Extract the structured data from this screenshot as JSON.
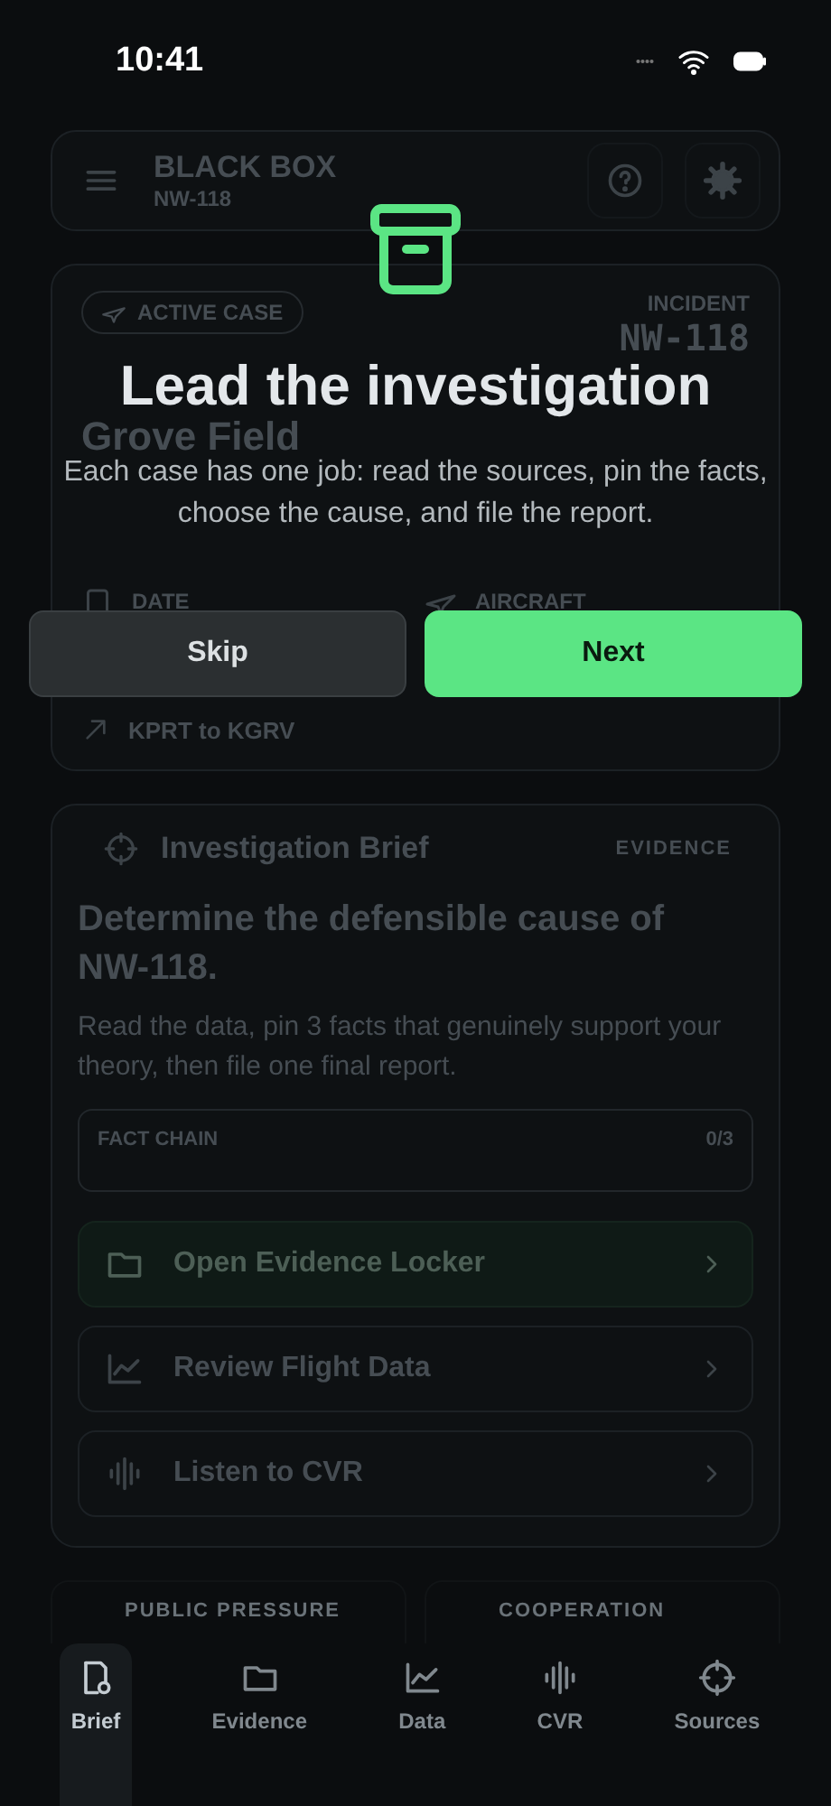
{
  "status_bar": {
    "time": "10:41"
  },
  "header": {
    "title": "BLACK BOX",
    "subtitle": "NW-118"
  },
  "case": {
    "badge": "ACTIVE CASE",
    "title": "Grove Field",
    "incident_label": "INCIDENT",
    "incident_id": "NW-118",
    "meta": [
      {
        "kind": "date",
        "label": "DATE"
      },
      {
        "kind": "aircraft",
        "label": "AIRCRAFT"
      }
    ],
    "route": "KPRT to KGRV"
  },
  "brief": {
    "title": "Investigation Brief",
    "tag": "EVIDENCE",
    "heading": "Determine the defensible cause of NW-118.",
    "body": "Read the data, pin 3 facts that genuinely support your theory, then file one final report.",
    "fact_chain": {
      "label": "FACT CHAIN",
      "count": "0/3"
    },
    "actions": [
      {
        "kind": "folder",
        "label": "Open Evidence Locker",
        "primary": true
      },
      {
        "kind": "chart",
        "label": "Review Flight Data",
        "primary": false
      },
      {
        "kind": "wave",
        "label": "Listen to CVR",
        "primary": false
      }
    ]
  },
  "stats": [
    {
      "label": "PUBLIC PRESSURE"
    },
    {
      "label": "COOPERATION"
    }
  ],
  "tabs": [
    {
      "kind": "doc",
      "label": "Brief",
      "selected": true
    },
    {
      "kind": "folder",
      "label": "Evidence",
      "selected": false
    },
    {
      "kind": "chart",
      "label": "Data",
      "selected": false
    },
    {
      "kind": "wave",
      "label": "CVR",
      "selected": false
    },
    {
      "kind": "target",
      "label": "Sources",
      "selected": false
    }
  ],
  "onboarding": {
    "title": "Lead the investigation",
    "body": "Each case has one job: read the sources, pin the facts, choose the cause, and file the report.",
    "buttons": [
      {
        "kind": "secondary",
        "label": "Skip"
      },
      {
        "kind": "primary",
        "label": "Next"
      }
    ]
  }
}
